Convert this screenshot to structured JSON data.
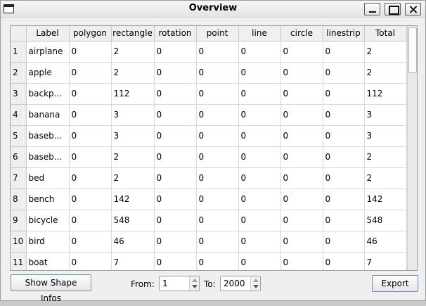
{
  "window": {
    "title": "Overview"
  },
  "table": {
    "columns": [
      "Label",
      "polygon",
      "rectangle",
      "rotation",
      "point",
      "line",
      "circle",
      "linestrip",
      "Total"
    ],
    "rows": [
      {
        "num": "1",
        "label": "airplane",
        "polygon": "0",
        "rectangle": "2",
        "rotation": "0",
        "point": "0",
        "line": "0",
        "circle": "0",
        "linestrip": "0",
        "total": "2"
      },
      {
        "num": "2",
        "label": "apple",
        "polygon": "0",
        "rectangle": "2",
        "rotation": "0",
        "point": "0",
        "line": "0",
        "circle": "0",
        "linestrip": "0",
        "total": "2"
      },
      {
        "num": "3",
        "label": "backp...",
        "polygon": "0",
        "rectangle": "112",
        "rotation": "0",
        "point": "0",
        "line": "0",
        "circle": "0",
        "linestrip": "0",
        "total": "112"
      },
      {
        "num": "4",
        "label": "banana",
        "polygon": "0",
        "rectangle": "3",
        "rotation": "0",
        "point": "0",
        "line": "0",
        "circle": "0",
        "linestrip": "0",
        "total": "3"
      },
      {
        "num": "5",
        "label": "baseb...",
        "polygon": "0",
        "rectangle": "3",
        "rotation": "0",
        "point": "0",
        "line": "0",
        "circle": "0",
        "linestrip": "0",
        "total": "3"
      },
      {
        "num": "6",
        "label": "baseb...",
        "polygon": "0",
        "rectangle": "2",
        "rotation": "0",
        "point": "0",
        "line": "0",
        "circle": "0",
        "linestrip": "0",
        "total": "2"
      },
      {
        "num": "7",
        "label": "bed",
        "polygon": "0",
        "rectangle": "2",
        "rotation": "0",
        "point": "0",
        "line": "0",
        "circle": "0",
        "linestrip": "0",
        "total": "2"
      },
      {
        "num": "8",
        "label": "bench",
        "polygon": "0",
        "rectangle": "142",
        "rotation": "0",
        "point": "0",
        "line": "0",
        "circle": "0",
        "linestrip": "0",
        "total": "142"
      },
      {
        "num": "9",
        "label": "bicycle",
        "polygon": "0",
        "rectangle": "548",
        "rotation": "0",
        "point": "0",
        "line": "0",
        "circle": "0",
        "linestrip": "0",
        "total": "548"
      },
      {
        "num": "10",
        "label": "bird",
        "polygon": "0",
        "rectangle": "46",
        "rotation": "0",
        "point": "0",
        "line": "0",
        "circle": "0",
        "linestrip": "0",
        "total": "46"
      },
      {
        "num": "11",
        "label": "boat",
        "polygon": "0",
        "rectangle": "7",
        "rotation": "0",
        "point": "0",
        "line": "0",
        "circle": "0",
        "linestrip": "0",
        "total": "7"
      }
    ]
  },
  "footer": {
    "show_shape_infos_label": "Show Shape Infos",
    "from_label": "From:",
    "from_value": "1",
    "to_label": "To:",
    "to_value": "2000",
    "export_label": "Export"
  }
}
